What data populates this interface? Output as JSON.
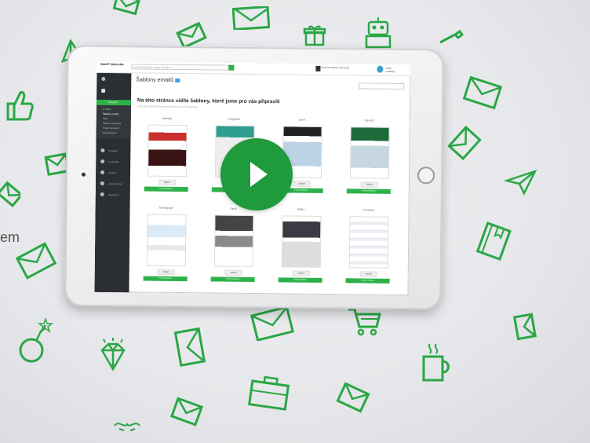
{
  "side_text": "em",
  "colors": {
    "accent": "#2db24a",
    "play": "#1f9a3c",
    "doodle": "#2aa745",
    "sidebar": "#2b2e33"
  },
  "icons": [
    "envelope-icon",
    "gift-icon",
    "robot-icon",
    "thumbs-up-icon",
    "paper-plane-icon",
    "bomb-icon",
    "diamond-icon",
    "briefcase-icon",
    "shopping-cart-icon",
    "coffee-mug-icon",
    "book-icon",
    "play-icon"
  ],
  "screen": {
    "logo": "SMART EMAILING",
    "search_placeholder": "vyhledat kontakty, emaily, kampaně ...",
    "account": "Smart Emailing • Účet plati",
    "user": "smart emailing",
    "page_title": "Šablony emailů",
    "heading": "Na této stránce vidíte šablony, které jsme pro vás připravili",
    "subheading": "Všechny můžete zdarma použít pro své kampaně.",
    "sidebar": {
      "active": "Kampaně",
      "sub_items": [
        "E-maily",
        "Šablony emailů",
        "SMS",
        "Splitové kampaně",
        "Trvalé kampaně",
        "Můj kampaně"
      ],
      "groups": [
        "Kontakty",
        "Formuláře",
        "Reporty",
        "Automatizace",
        "Nastavení"
      ]
    },
    "templates": [
      {
        "name": "Valentýn",
        "preview": "Náhled",
        "use": "Použít šablonu"
      },
      {
        "name": "Elegantní",
        "preview": "Náhled",
        "use": "Použít šablonu"
      },
      {
        "name": "Zimní",
        "preview": "Náhled",
        "use": "Použít šablonu"
      },
      {
        "name": "Vánoční",
        "preview": "Náhled",
        "use": "Použít šablonu"
      },
      {
        "name": "Technologie",
        "preview": "Náhled",
        "use": "Použít šablonu"
      },
      {
        "name": "Sport",
        "preview": "Náhled",
        "use": "Použít šablonu"
      },
      {
        "name": "Město",
        "preview": "Náhled",
        "use": "Použít šablonu"
      },
      {
        "name": "Produkty",
        "preview": "Náhled",
        "use": "Použít šablonu"
      }
    ]
  }
}
